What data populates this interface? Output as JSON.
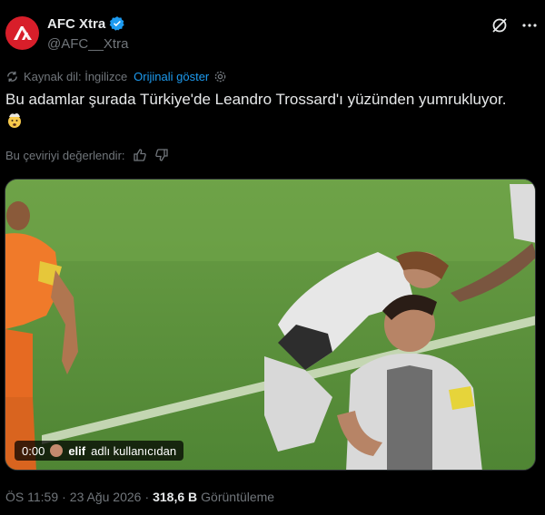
{
  "author": {
    "display_name": "AFC Xtra",
    "handle": "@AFC__Xtra",
    "verified": true
  },
  "header_icons": [
    "grok-icon",
    "more-icon"
  ],
  "translation": {
    "source_label": "Kaynak dil: İngilizce",
    "show_original": "Orijinali göster"
  },
  "tweet": {
    "text": "Bu adamlar şurada Türkiye'de Leandro Trossard'ı yüzünden yumrukluyor."
  },
  "rating": {
    "label": "Bu çeviriyi değerlendir:"
  },
  "video": {
    "time": "0:00",
    "uploader": "elif",
    "uploader_suffix": "adlı kullanıcıdan"
  },
  "meta": {
    "time": "ÖS 11:59",
    "date": "23 Ağu 2026",
    "views_count": "318,6 B",
    "views_label": "Görüntüleme"
  },
  "colors": {
    "accent": "#1d9bf0",
    "secondary_text": "#71767b",
    "avatar_bg": "#d81e2a"
  }
}
